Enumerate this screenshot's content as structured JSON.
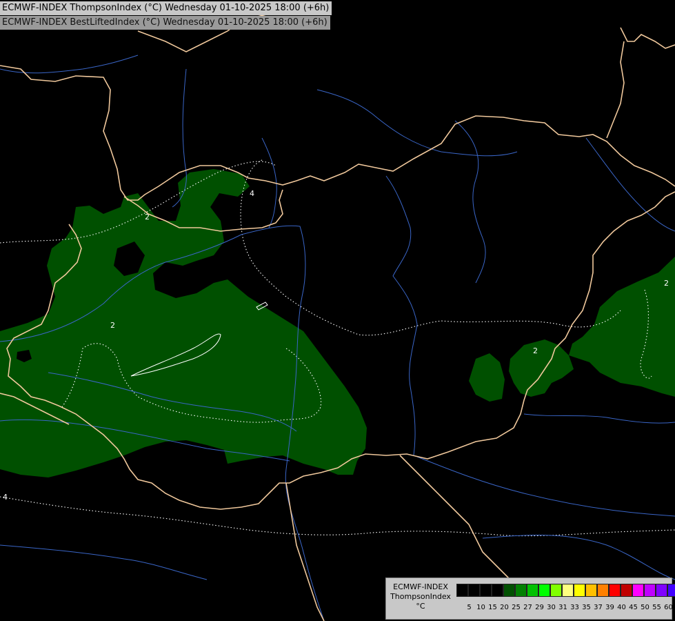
{
  "titles": {
    "line1": "ECMWF-INDEX ThompsonIndex (°C) Wednesday 01-10-2025 18:00 (+6h)",
    "line2": "ECMWF-INDEX BestLiftedIndex (°C) Wednesday 01-10-2025 18:00 (+6h)"
  },
  "legend": {
    "line1": "ECMWF-INDEX",
    "line2": "ThompsonIndex",
    "line3": "°C",
    "ticks": [
      "5",
      "10",
      "15",
      "20",
      "25",
      "27",
      "29",
      "30",
      "31",
      "33",
      "35",
      "37",
      "39",
      "40",
      "45",
      "50",
      "55",
      "60"
    ],
    "colors": [
      "#000000",
      "#000000",
      "#000000",
      "#000000",
      "#005000",
      "#008000",
      "#00c000",
      "#00ff00",
      "#80ff00",
      "#ffff80",
      "#ffff00",
      "#ffc000",
      "#ff8000",
      "#ff0000",
      "#c00000",
      "#ff00ff",
      "#c000ff",
      "#8000ff",
      "#4000ff",
      "#0000ff"
    ]
  },
  "contour_labels": [
    "2",
    "2",
    "2",
    "2",
    "4",
    "4"
  ],
  "colors": {
    "fill_zone": "#005000",
    "border": "#f0c89c",
    "river": "#3a66c8",
    "contour": "#ffffff"
  }
}
